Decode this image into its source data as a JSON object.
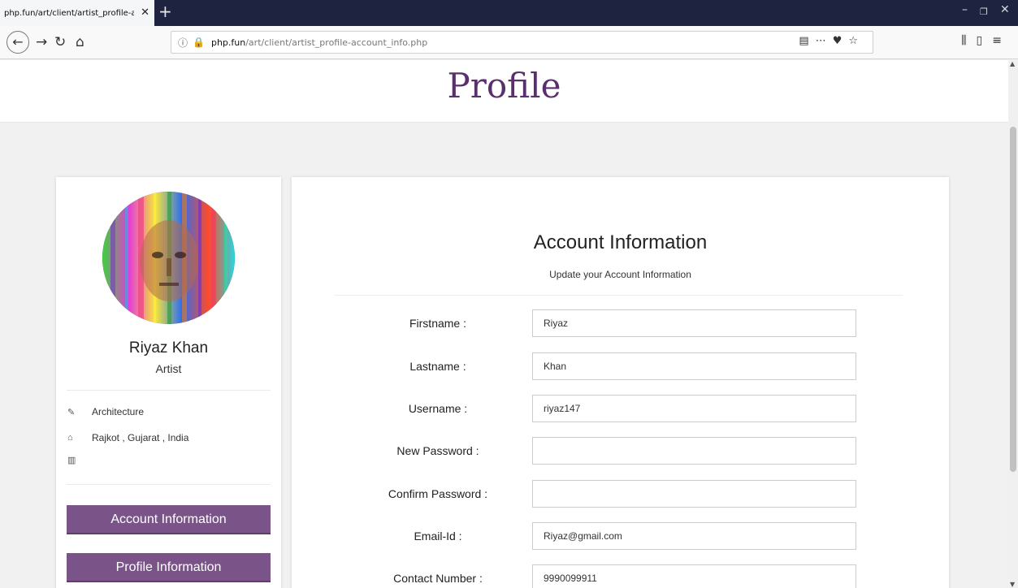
{
  "browser": {
    "tab_title": "php.fun/art/client/artist_profile-acc",
    "url_domain": "php.fun",
    "url_path": "/art/client/artist_profile-account_info.php"
  },
  "page": {
    "title": "Profile"
  },
  "profile": {
    "name": "Riyaz Khan",
    "role": "Artist",
    "category": "Architecture",
    "location": "Rajkot , Gujarat , India",
    "buttons": {
      "account": "Account Information",
      "profile": "Profile Information"
    }
  },
  "account_form": {
    "title": "Account Information",
    "subtitle": "Update your Account Information",
    "fields": {
      "firstname_label": "Firstname :",
      "firstname_value": "Riyaz",
      "lastname_label": "Lastname :",
      "lastname_value": "Khan",
      "username_label": "Username :",
      "username_value": "riyaz147",
      "new_password_label": "New Password :",
      "new_password_value": "",
      "confirm_password_label": "Confirm Password :",
      "confirm_password_value": "",
      "email_label": "Email-Id :",
      "email_value": "Riyaz@gmail.com",
      "contact_label": "Contact Number :",
      "contact_value": "9990099911"
    }
  },
  "colors": {
    "accent": "#7a5488",
    "title": "#5a2f6d",
    "tabbar": "#1e2440"
  }
}
